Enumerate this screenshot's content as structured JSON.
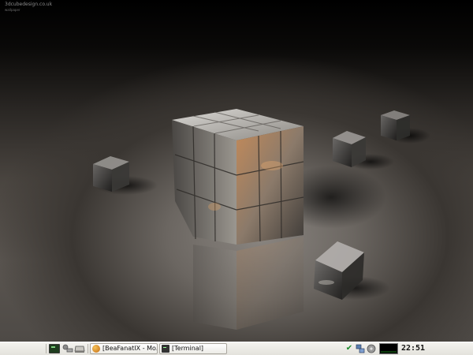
{
  "desktop": {
    "watermark_line1": "3dcubedesign.co.uk",
    "watermark_line2": "wallpaper"
  },
  "taskbar": {
    "launchers": [
      "terminal-icon",
      "tools-icon",
      "drive-icon"
    ],
    "tasks": [
      {
        "label": "[BeaFanatIX - Mo..."
      },
      {
        "label": "[Terminal]"
      }
    ],
    "tray": {
      "icons": [
        "update-check-icon",
        "network-icon",
        "disk-icon"
      ],
      "clock": "22:51"
    }
  }
}
